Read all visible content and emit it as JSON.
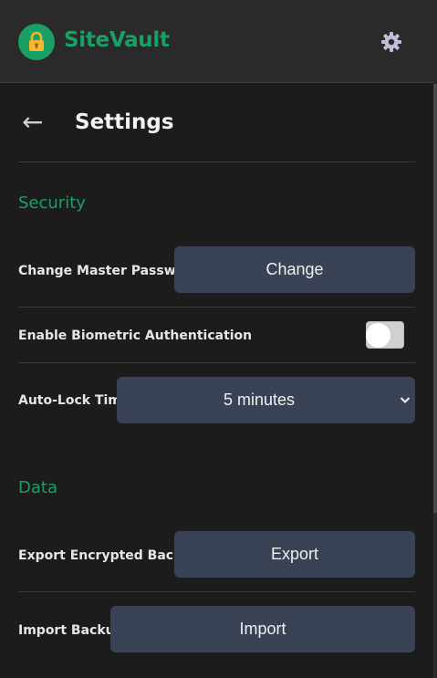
{
  "app": {
    "title": "SiteVault",
    "brand_color": "#1aa064",
    "logo_icon": "lock-icon",
    "settings_icon": "gear-icon"
  },
  "page": {
    "title": "Settings",
    "back_icon": "arrow-left-icon"
  },
  "security": {
    "section_title": "Security",
    "change_password": {
      "label": "Change Master Password",
      "button": "Change"
    },
    "biometric": {
      "label": "Enable Biometric Authentication",
      "enabled": false
    },
    "auto_lock": {
      "label": "Auto-Lock Time",
      "selected": "5 minutes"
    }
  },
  "data_section": {
    "section_title": "Data",
    "export": {
      "label": "Export Encrypted Backup",
      "button": "Export"
    },
    "import": {
      "label": "Import Backup",
      "button": "Import"
    }
  },
  "back_arrow": "←"
}
